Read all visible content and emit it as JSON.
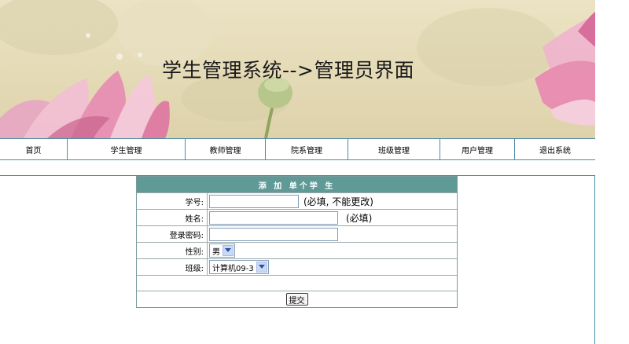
{
  "banner": {
    "title": "学生管理系统-->管理员界面"
  },
  "nav": {
    "items": [
      {
        "label": "首页"
      },
      {
        "label": "学生管理"
      },
      {
        "label": "教师管理"
      },
      {
        "label": "院系管理"
      },
      {
        "label": "班级管理"
      },
      {
        "label": "用户管理"
      },
      {
        "label": "退出系统"
      }
    ]
  },
  "form": {
    "header": "添 加 单个学 生",
    "student_id": {
      "label": "学号:",
      "value": "",
      "hint": "(必填, 不能更改)"
    },
    "name": {
      "label": "姓名:",
      "value": "",
      "hint": "(必填)"
    },
    "password": {
      "label": "登录密码:",
      "value": ""
    },
    "gender": {
      "label": "性别:",
      "selected": "男"
    },
    "class": {
      "label": "班级:",
      "selected": "计算机09-3"
    },
    "submit_label": "提交"
  },
  "colors": {
    "nav_border": "#4d8ba6",
    "form_header_bg": "#5f9a96",
    "banner_bg": "#e6ddbb"
  }
}
